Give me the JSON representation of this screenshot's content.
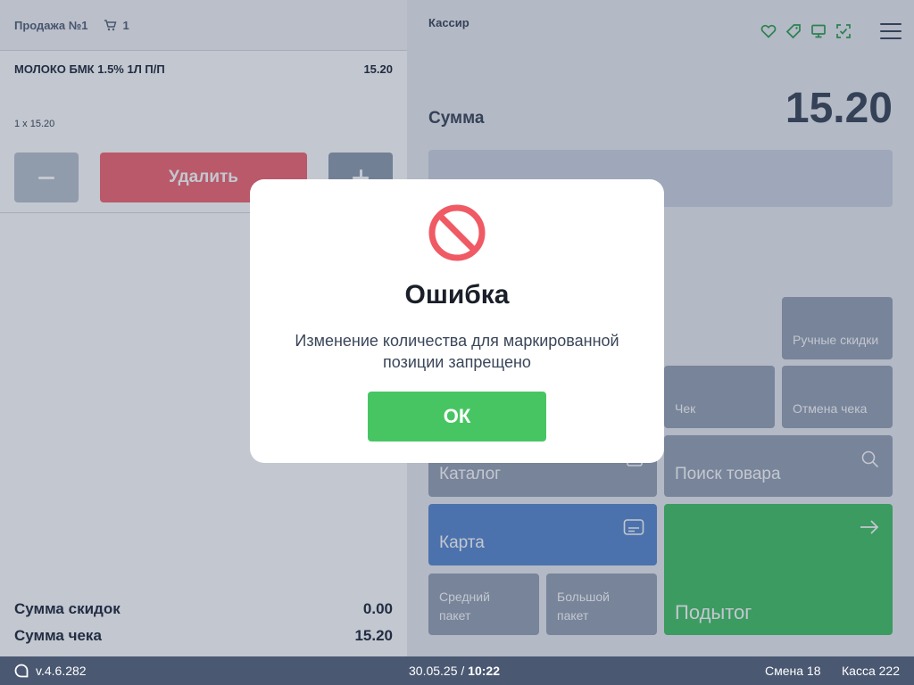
{
  "cart": {
    "title": "Продажа №1",
    "count": "1",
    "item": {
      "name": "МОЛОКО БМК 1.5% 1Л П/П",
      "price": "15.20",
      "qty_line": "1 x 15.20"
    },
    "delete_label": "Удалить",
    "totals": [
      {
        "label": "Сумма скидок",
        "value": "0.00"
      },
      {
        "label": "Сумма чека",
        "value": "15.20"
      }
    ]
  },
  "right": {
    "cashier": "Кассир",
    "sum_label": "Сумма",
    "sum_value": "15.20",
    "tiles": {
      "manual_discounts": "Ручные скидки",
      "receipt": "Чек",
      "cancel_receipt": "Отмена чека",
      "catalog": "Каталог",
      "search": "Поиск товара",
      "card": "Карта",
      "medium_bag": "Средний пакет",
      "large_bag": "Большой пакет",
      "subtotal": "Подытог"
    }
  },
  "footer": {
    "version": "v.4.6.282",
    "date": "30.05.25 /",
    "time": "10:22",
    "shift": "Смена 18",
    "kassa": "Касса 222"
  },
  "modal": {
    "title": "Ошибка",
    "message": "Изменение количества для маркированной позиции запрещено",
    "ok_label": "ОК"
  },
  "colors": {
    "error_icon": "#f05a64",
    "ok_button": "#48c563",
    "delete_button": "#f16773",
    "card_tile": "#5b8ad0",
    "subtotal_tile": "#43c266",
    "status_icons": "#2e9e4f",
    "footer": "#4a5872"
  },
  "icons": [
    "cart-icon",
    "heart-icon",
    "tag-icon",
    "monitor-icon",
    "scan-icon",
    "menu-icon",
    "catalog-icon",
    "search-icon",
    "card-icon",
    "arrow-right-icon",
    "logo-icon",
    "forbidden-icon"
  ]
}
